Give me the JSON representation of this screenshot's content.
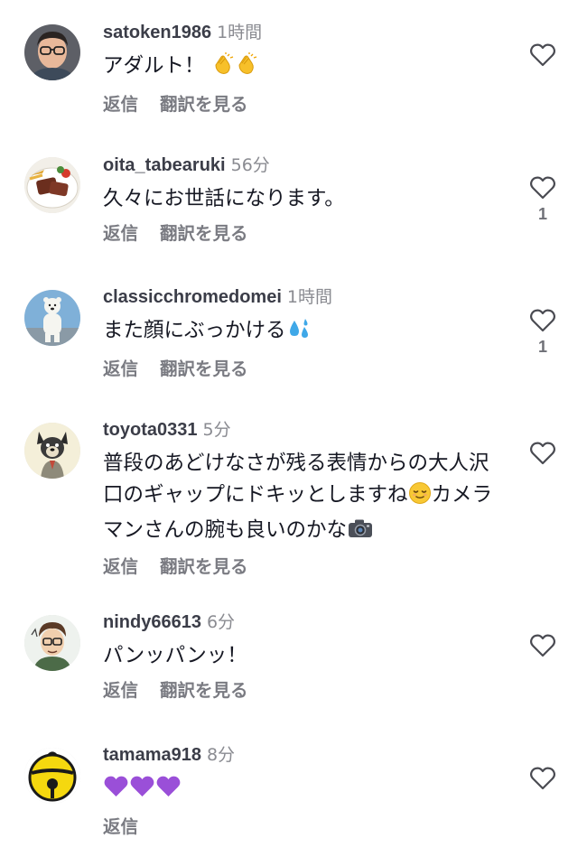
{
  "ui": {
    "reply_label": "返信",
    "translate_label": "翻訳を見る"
  },
  "comments": [
    {
      "username": "satoken1986",
      "time": "1時間",
      "text": "アダルト！",
      "emojis": [
        "clapping-hands-emoji",
        "clapping-hands-emoji"
      ],
      "likes": "",
      "show_translate": true,
      "avatar": "person-with-glasses"
    },
    {
      "username": "oita_tabearuki",
      "time": "56分",
      "text": "久々にお世話になります。",
      "emojis": [],
      "likes": "1",
      "show_translate": true,
      "avatar": "steak-plate"
    },
    {
      "username": "classicchromedomei",
      "time": "1時間",
      "text": "また顔にぶっかける",
      "emojis": [
        "sweat-droplets-emoji"
      ],
      "likes": "1",
      "show_translate": true,
      "avatar": "polar-bear-statue"
    },
    {
      "username": "toyota0331",
      "time": "5分",
      "text": "普段のあどけなさが残る表情からの大人沢口のギャップにドキッとしますね",
      "text_after_emoji": "カメラマンさんの腕も良いのかな",
      "emojis": [
        "relieved-face-emoji",
        "camera-emoji"
      ],
      "likes": "",
      "show_translate": true,
      "avatar": "dog-illustration"
    },
    {
      "username": "nindy66613",
      "time": "6分",
      "text": "パンッパンッ！",
      "emojis": [],
      "likes": "",
      "show_translate": true,
      "avatar": "cartoon-man-glasses"
    },
    {
      "username": "tamama918",
      "time": "8分",
      "text": "",
      "emojis": [
        "purple-heart-emoji",
        "purple-heart-emoji",
        "purple-heart-emoji"
      ],
      "likes": "",
      "show_translate": false,
      "avatar": "yellow-bell"
    }
  ]
}
